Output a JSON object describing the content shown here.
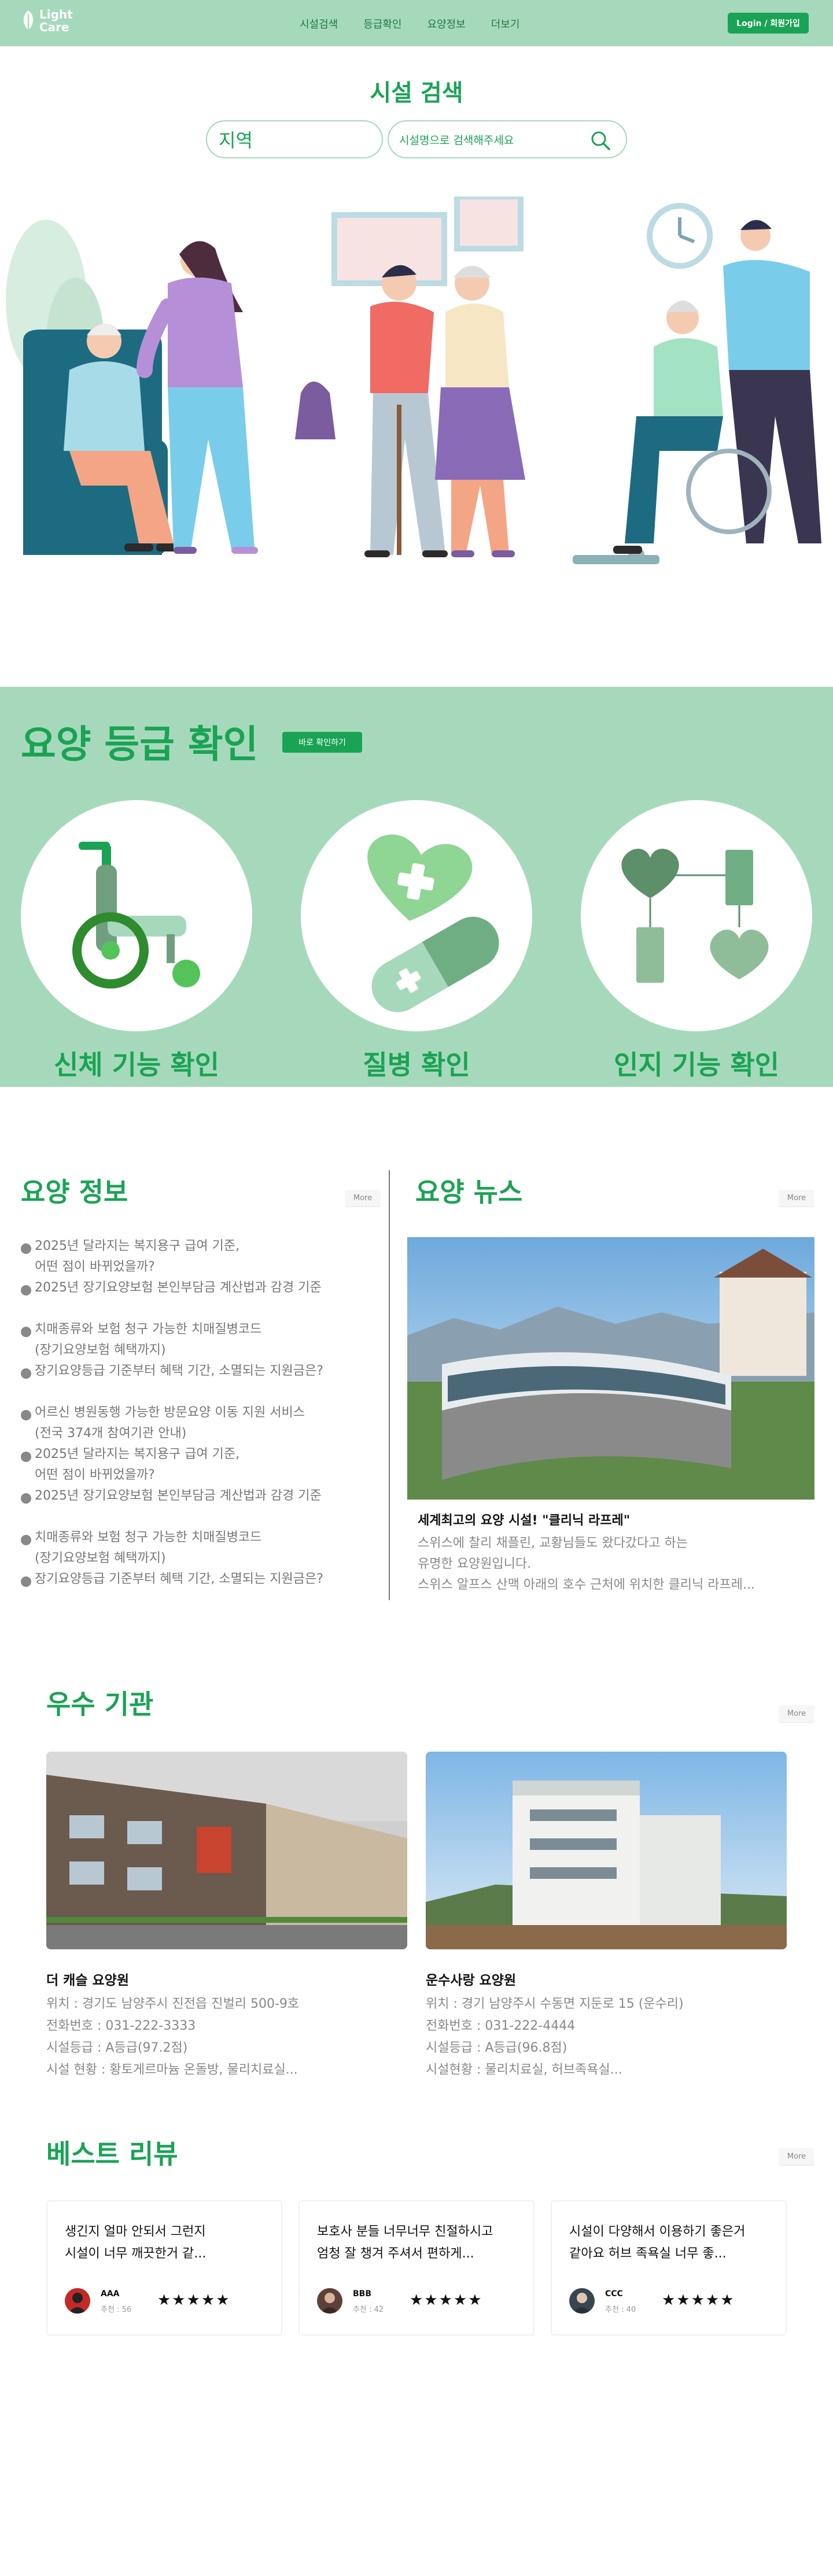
{
  "nav": {
    "logo_text": "Light Care",
    "links": [
      "시설검색",
      "등급확인",
      "요양정보",
      "더보기"
    ],
    "login_label": "Login / 회원가입"
  },
  "search": {
    "title": "시설 검색",
    "region_label": "지역",
    "placeholder": "시설명으로 검색해주세요"
  },
  "grade": {
    "title": "요양 등급 확인",
    "button_label": "바로 확인하기",
    "cards": [
      "신체 기능 확인",
      "질병 확인",
      "인지 기능 확인"
    ]
  },
  "info": {
    "title": "요양 정보",
    "more_label": "More",
    "groups": [
      [
        "2025년 달라지는 복지용구 급여 기준,\n어떤 점이 바뀌었을까?",
        "2025년 장기요양보험 본인부담금 계산법과 감경 기준"
      ],
      [
        "치매종류와 보험 청구 가능한 치매질병코드\n(장기요양보험 혜택까지)",
        "장기요양등급 기준부터 혜택 기간, 소멸되는 지원금은?"
      ],
      [
        "어르신 병원동행 가능한 방문요양 이동 지원 서비스\n(전국 374개 참여기관 안내)",
        "2025년 달라지는 복지용구 급여 기준,\n어떤 점이 바뀌었을까?",
        "2025년 장기요양보험 본인부담금 계산법과 감경 기준"
      ],
      [
        "치매종류와 보험 청구 가능한 치매질병코드\n(장기요양보험 혜택까지)",
        "장기요양등급 기준부터 혜택 기간, 소멸되는 지원금은?"
      ]
    ]
  },
  "news": {
    "title": "요양 뉴스",
    "more_label": "More",
    "headline": "세계최고의 요양 시설! \"클리닉 라프레\"",
    "body": "스위스에 찰리 채플린, 교황님들도 왔다갔다고 하는\n유명한 요양원입니다.\n스위스 알프스 산맥 아래의 호수 근처에 위치한 클리닉 라프레..."
  },
  "excellent": {
    "title": "우수 기관",
    "more_label": "More",
    "institutions": [
      {
        "name": "더 캐슬 요양원",
        "location": "위치 : 경기도 남양주시 진전읍 진벌리 500-9호",
        "phone": "전화번호 : 031-222-3333",
        "grade": "시설등급 : A등급(97.2점)",
        "facilities": "시설 현황 : 황토게르마늄 온돌방, 물리치료실..."
      },
      {
        "name": "운수사랑 요양원",
        "location": "위치 : 경기 남양주시 수동면 지둔로 15 (운수리)",
        "phone": "전화번호 : 031-222-4444",
        "grade": "시설등급 : A등급(96.8점)",
        "facilities": "시설현황 :  물리치료실, 허브족욕실..."
      }
    ]
  },
  "reviews": {
    "title": "베스트 리뷰",
    "more_label": "More",
    "items": [
      {
        "text": "생긴지 얼마 안되서 그런지\n시설이 너무 깨끗한거 같...",
        "name": "AAA",
        "rec": "추천 : 56",
        "stars": "★★★★★",
        "avatar_color": "#c62828"
      },
      {
        "text": "보호사 분들 너무너무 친절하시고\n엄청 잘 챙겨 주셔서 편하게...",
        "name": "BBB",
        "rec": "추천 : 42",
        "stars": "★★★★★",
        "avatar_color": "#5d4037"
      },
      {
        "text": "시설이 다양해서 이용하기 좋은거\n같아요 허브 족욕실 너무 좋...",
        "name": "CCC",
        "rec": "추천 : 40",
        "stars": "★★★★★",
        "avatar_color": "#37474f"
      }
    ]
  },
  "colors": {
    "brand_green": "#1aa354",
    "mint": "#a6d9bb"
  }
}
